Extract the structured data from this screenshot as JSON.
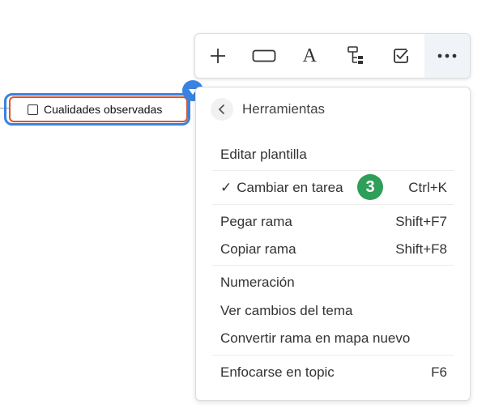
{
  "node": {
    "label": "Cualidades observadas"
  },
  "toolbar": {
    "buttons": [
      {
        "name": "add-icon"
      },
      {
        "name": "shape-icon"
      },
      {
        "name": "text-icon",
        "glyph": "A"
      },
      {
        "name": "structure-icon"
      },
      {
        "name": "task-checkbox-icon"
      },
      {
        "name": "more-icon"
      }
    ]
  },
  "menu": {
    "title": "Herramientas",
    "items": {
      "edit_template": {
        "label": "Editar plantilla"
      },
      "toggle_task": {
        "check": "✓",
        "label": "Cambiar en tarea",
        "shortcut": "Ctrl+K",
        "badge": "3"
      },
      "paste_branch": {
        "label": "Pegar rama",
        "shortcut": "Shift+F7"
      },
      "copy_branch": {
        "label": "Copiar rama",
        "shortcut": "Shift+F8"
      },
      "numbering": {
        "label": "Numeración"
      },
      "theme_changes": {
        "label": "Ver cambios del tema"
      },
      "convert_branch": {
        "label": "Convertir rama en mapa nuevo"
      },
      "focus_topic": {
        "label": "Enfocarse en topic",
        "shortcut": "F6"
      }
    }
  },
  "colors": {
    "selection_blue": "#3a82e0",
    "node_border": "#d9562f",
    "badge_green": "#2f9e58"
  }
}
